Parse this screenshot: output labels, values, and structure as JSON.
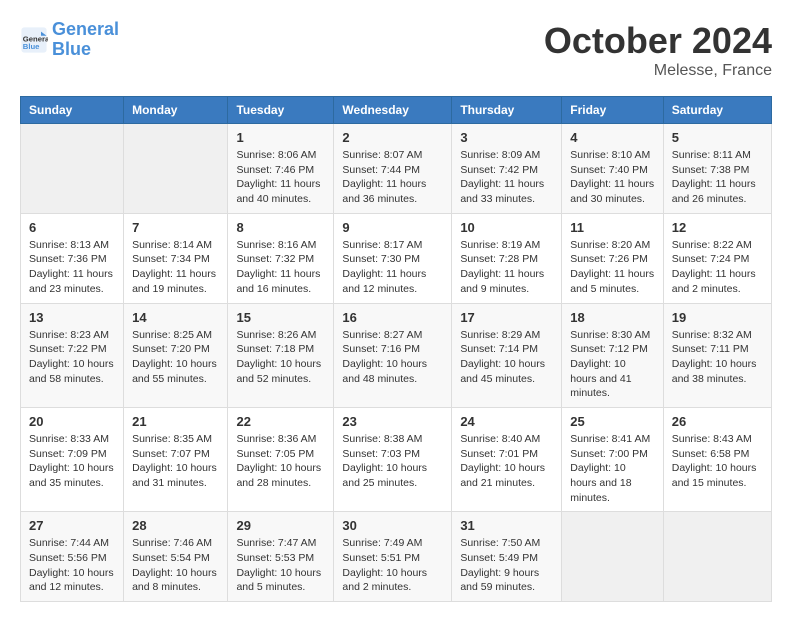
{
  "header": {
    "logo_general": "General",
    "logo_blue": "Blue",
    "month": "October 2024",
    "location": "Melesse, France"
  },
  "weekdays": [
    "Sunday",
    "Monday",
    "Tuesday",
    "Wednesday",
    "Thursday",
    "Friday",
    "Saturday"
  ],
  "weeks": [
    [
      {
        "day": "",
        "empty": true
      },
      {
        "day": "",
        "empty": true
      },
      {
        "day": "1",
        "sunrise": "Sunrise: 8:06 AM",
        "sunset": "Sunset: 7:46 PM",
        "daylight": "Daylight: 11 hours and 40 minutes."
      },
      {
        "day": "2",
        "sunrise": "Sunrise: 8:07 AM",
        "sunset": "Sunset: 7:44 PM",
        "daylight": "Daylight: 11 hours and 36 minutes."
      },
      {
        "day": "3",
        "sunrise": "Sunrise: 8:09 AM",
        "sunset": "Sunset: 7:42 PM",
        "daylight": "Daylight: 11 hours and 33 minutes."
      },
      {
        "day": "4",
        "sunrise": "Sunrise: 8:10 AM",
        "sunset": "Sunset: 7:40 PM",
        "daylight": "Daylight: 11 hours and 30 minutes."
      },
      {
        "day": "5",
        "sunrise": "Sunrise: 8:11 AM",
        "sunset": "Sunset: 7:38 PM",
        "daylight": "Daylight: 11 hours and 26 minutes."
      }
    ],
    [
      {
        "day": "6",
        "sunrise": "Sunrise: 8:13 AM",
        "sunset": "Sunset: 7:36 PM",
        "daylight": "Daylight: 11 hours and 23 minutes."
      },
      {
        "day": "7",
        "sunrise": "Sunrise: 8:14 AM",
        "sunset": "Sunset: 7:34 PM",
        "daylight": "Daylight: 11 hours and 19 minutes."
      },
      {
        "day": "8",
        "sunrise": "Sunrise: 8:16 AM",
        "sunset": "Sunset: 7:32 PM",
        "daylight": "Daylight: 11 hours and 16 minutes."
      },
      {
        "day": "9",
        "sunrise": "Sunrise: 8:17 AM",
        "sunset": "Sunset: 7:30 PM",
        "daylight": "Daylight: 11 hours and 12 minutes."
      },
      {
        "day": "10",
        "sunrise": "Sunrise: 8:19 AM",
        "sunset": "Sunset: 7:28 PM",
        "daylight": "Daylight: 11 hours and 9 minutes."
      },
      {
        "day": "11",
        "sunrise": "Sunrise: 8:20 AM",
        "sunset": "Sunset: 7:26 PM",
        "daylight": "Daylight: 11 hours and 5 minutes."
      },
      {
        "day": "12",
        "sunrise": "Sunrise: 8:22 AM",
        "sunset": "Sunset: 7:24 PM",
        "daylight": "Daylight: 11 hours and 2 minutes."
      }
    ],
    [
      {
        "day": "13",
        "sunrise": "Sunrise: 8:23 AM",
        "sunset": "Sunset: 7:22 PM",
        "daylight": "Daylight: 10 hours and 58 minutes."
      },
      {
        "day": "14",
        "sunrise": "Sunrise: 8:25 AM",
        "sunset": "Sunset: 7:20 PM",
        "daylight": "Daylight: 10 hours and 55 minutes."
      },
      {
        "day": "15",
        "sunrise": "Sunrise: 8:26 AM",
        "sunset": "Sunset: 7:18 PM",
        "daylight": "Daylight: 10 hours and 52 minutes."
      },
      {
        "day": "16",
        "sunrise": "Sunrise: 8:27 AM",
        "sunset": "Sunset: 7:16 PM",
        "daylight": "Daylight: 10 hours and 48 minutes."
      },
      {
        "day": "17",
        "sunrise": "Sunrise: 8:29 AM",
        "sunset": "Sunset: 7:14 PM",
        "daylight": "Daylight: 10 hours and 45 minutes."
      },
      {
        "day": "18",
        "sunrise": "Sunrise: 8:30 AM",
        "sunset": "Sunset: 7:12 PM",
        "daylight": "Daylight: 10 hours and 41 minutes."
      },
      {
        "day": "19",
        "sunrise": "Sunrise: 8:32 AM",
        "sunset": "Sunset: 7:11 PM",
        "daylight": "Daylight: 10 hours and 38 minutes."
      }
    ],
    [
      {
        "day": "20",
        "sunrise": "Sunrise: 8:33 AM",
        "sunset": "Sunset: 7:09 PM",
        "daylight": "Daylight: 10 hours and 35 minutes."
      },
      {
        "day": "21",
        "sunrise": "Sunrise: 8:35 AM",
        "sunset": "Sunset: 7:07 PM",
        "daylight": "Daylight: 10 hours and 31 minutes."
      },
      {
        "day": "22",
        "sunrise": "Sunrise: 8:36 AM",
        "sunset": "Sunset: 7:05 PM",
        "daylight": "Daylight: 10 hours and 28 minutes."
      },
      {
        "day": "23",
        "sunrise": "Sunrise: 8:38 AM",
        "sunset": "Sunset: 7:03 PM",
        "daylight": "Daylight: 10 hours and 25 minutes."
      },
      {
        "day": "24",
        "sunrise": "Sunrise: 8:40 AM",
        "sunset": "Sunset: 7:01 PM",
        "daylight": "Daylight: 10 hours and 21 minutes."
      },
      {
        "day": "25",
        "sunrise": "Sunrise: 8:41 AM",
        "sunset": "Sunset: 7:00 PM",
        "daylight": "Daylight: 10 hours and 18 minutes."
      },
      {
        "day": "26",
        "sunrise": "Sunrise: 8:43 AM",
        "sunset": "Sunset: 6:58 PM",
        "daylight": "Daylight: 10 hours and 15 minutes."
      }
    ],
    [
      {
        "day": "27",
        "sunrise": "Sunrise: 7:44 AM",
        "sunset": "Sunset: 5:56 PM",
        "daylight": "Daylight: 10 hours and 12 minutes."
      },
      {
        "day": "28",
        "sunrise": "Sunrise: 7:46 AM",
        "sunset": "Sunset: 5:54 PM",
        "daylight": "Daylight: 10 hours and 8 minutes."
      },
      {
        "day": "29",
        "sunrise": "Sunrise: 7:47 AM",
        "sunset": "Sunset: 5:53 PM",
        "daylight": "Daylight: 10 hours and 5 minutes."
      },
      {
        "day": "30",
        "sunrise": "Sunrise: 7:49 AM",
        "sunset": "Sunset: 5:51 PM",
        "daylight": "Daylight: 10 hours and 2 minutes."
      },
      {
        "day": "31",
        "sunrise": "Sunrise: 7:50 AM",
        "sunset": "Sunset: 5:49 PM",
        "daylight": "Daylight: 9 hours and 59 minutes."
      },
      {
        "day": "",
        "empty": true
      },
      {
        "day": "",
        "empty": true
      }
    ]
  ]
}
